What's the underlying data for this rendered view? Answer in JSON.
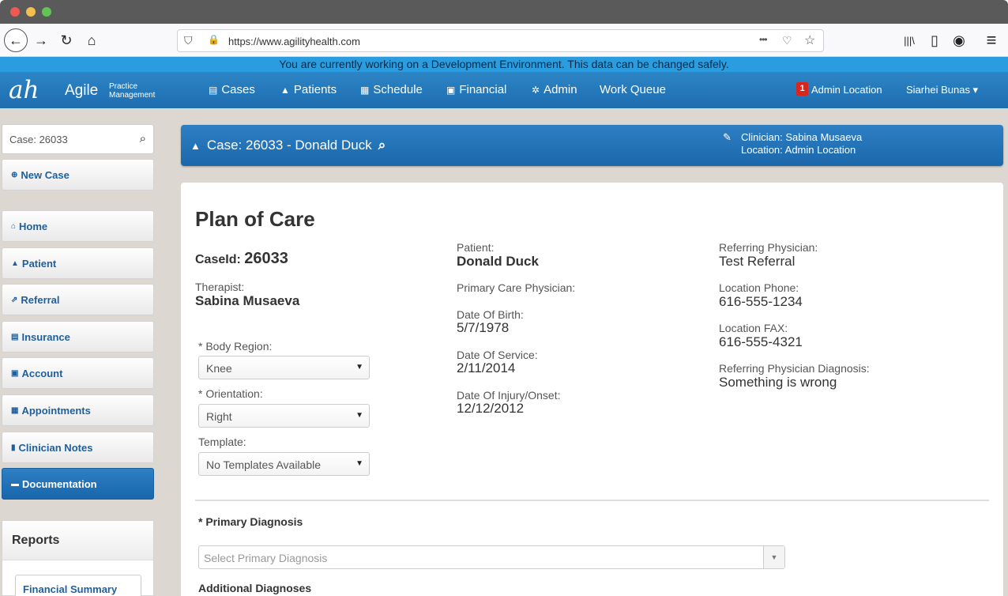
{
  "browser": {
    "url": "https://www.agilityhealth.com",
    "back_icon": "←",
    "forward_icon": "→",
    "reload_icon": "↻",
    "home_icon": "⌂",
    "shield_icon": "⛉",
    "lock_icon": "🔒",
    "more_icon": "•••",
    "pocket_icon": "♡",
    "star_icon": "☆",
    "library_icon": "|||\\",
    "sidebar_icon": "▯",
    "account_icon": "◉",
    "menu_icon": "≡"
  },
  "banner": "You are currently working on a Development Environment. This data can be changed safely.",
  "header": {
    "logo": "ah",
    "app_name": "Agile",
    "app_sub_1": "Practice",
    "app_sub_2": "Management",
    "nav": [
      {
        "icon": "▤",
        "label": "Cases"
      },
      {
        "icon": "▲",
        "label": "Patients"
      },
      {
        "icon": "▦",
        "label": "Schedule"
      },
      {
        "icon": "▣",
        "label": "Financial"
      },
      {
        "icon": "✲",
        "label": "Admin"
      },
      {
        "icon": "",
        "label": "Work Queue"
      }
    ],
    "badge": "1",
    "location": "Admin Location",
    "user": "Siarhei Bunas ▾"
  },
  "sidebar": {
    "search_value": "Case: 26033",
    "search_icon": "⌕",
    "new_case": {
      "icon": "⊕",
      "label": "New Case"
    },
    "items": [
      {
        "icon": "⌂",
        "label": "Home"
      },
      {
        "icon": "▲",
        "label": "Patient"
      },
      {
        "icon": "⇗",
        "label": "Referral"
      },
      {
        "icon": "▤",
        "label": "Insurance"
      },
      {
        "icon": "▣",
        "label": "Account"
      },
      {
        "icon": "▦",
        "label": "Appointments"
      },
      {
        "icon": "▮",
        "label": "Clinician Notes"
      },
      {
        "icon": "▬",
        "label": "Documentation"
      }
    ],
    "reports_title": "Reports",
    "reports_link": "Financial Summary"
  },
  "casebar": {
    "user_icon": "▲",
    "title": "Case: 26033 - Donald Duck",
    "search_icon": "⌕",
    "edit_icon": "✎",
    "clinician": "Clinician: Sabina Musaeva",
    "location": "Location: Admin Location"
  },
  "plan": {
    "title": "Plan of Care",
    "caseid_label": "CaseId:",
    "caseid_value": "26033",
    "therapist_label": "Therapist:",
    "therapist_value": "Sabina Musaeva",
    "body_region_label": "* Body Region:",
    "body_region_value": "Knee",
    "orientation_label": "* Orientation:",
    "orientation_value": "Right",
    "template_label": "Template:",
    "template_value": "No Templates Available",
    "patient_label": "Patient:",
    "patient_value": "Donald Duck",
    "pcp_label": "Primary Care Physician:",
    "dob_label": "Date Of Birth:",
    "dob_value": "5/7/1978",
    "dos_label": "Date Of Service:",
    "dos_value": "2/11/2014",
    "doi_label": "Date Of Injury/Onset:",
    "doi_value": "12/12/2012",
    "ref_phys_label": "Referring Physician:",
    "ref_phys_value": "Test Referral",
    "loc_phone_label": "Location Phone:",
    "loc_phone_value": "616-555-1234",
    "loc_fax_label": "Location FAX:",
    "loc_fax_value": "616-555-4321",
    "ref_diag_label": "Referring Physician Diagnosis:",
    "ref_diag_value": "Something is wrong",
    "primary_diag_head": "* Primary Diagnosis",
    "primary_diag_placeholder": "Select Primary Diagnosis",
    "additional_diag_head": "Additional Diagnoses",
    "dropdown_arrow": "▼"
  }
}
